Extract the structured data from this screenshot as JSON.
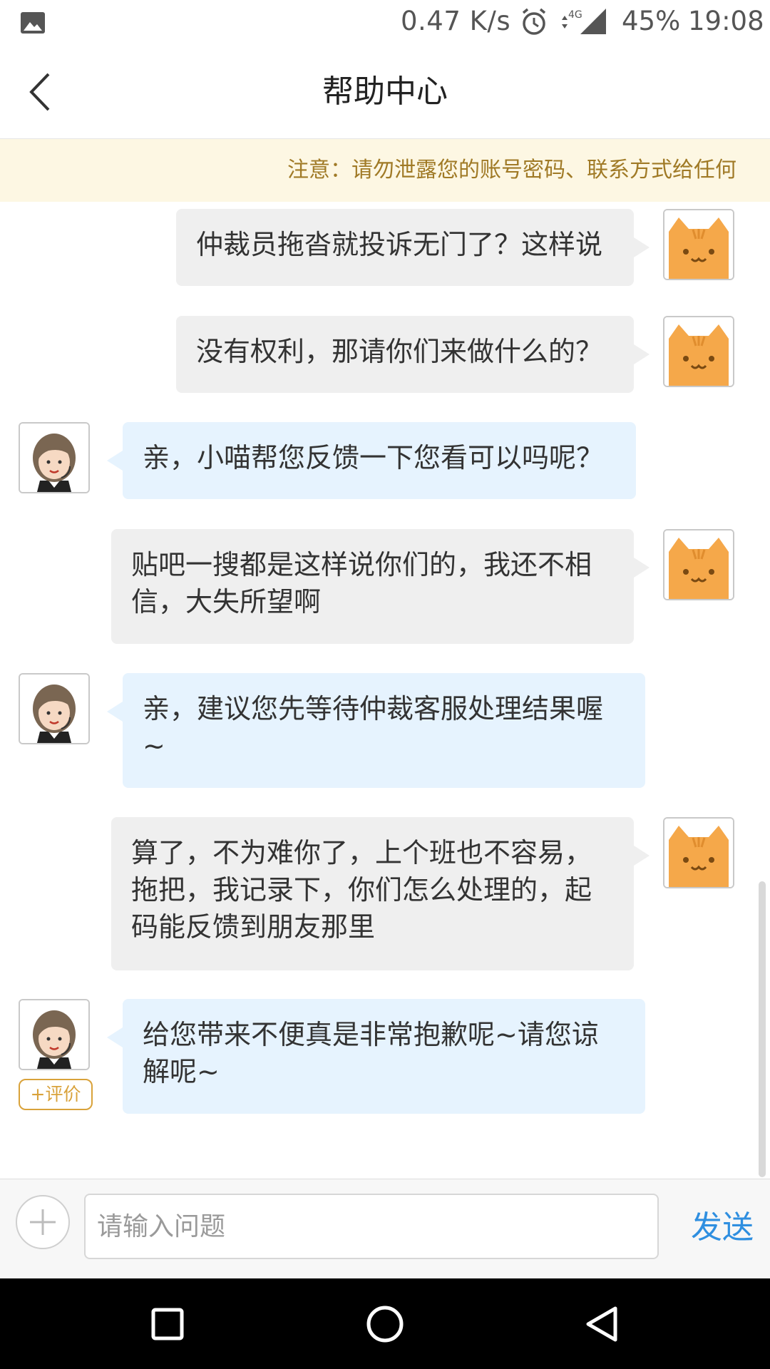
{
  "status_bar": {
    "network_speed": "0.47 K/s",
    "network_type": "4G",
    "battery": "45%",
    "time": "19:08"
  },
  "header": {
    "title": "帮助中心"
  },
  "notice": {
    "text": "注意：请勿泄露您的账号密码、联系方式给任何"
  },
  "messages": [
    {
      "sender": "user",
      "text": "仲裁员拖沓就投诉无门了？这样说"
    },
    {
      "sender": "user",
      "text": "没有权利，那请你们来做什么的？"
    },
    {
      "sender": "agent",
      "text": "亲，小喵帮您反馈一下您看可以吗呢？"
    },
    {
      "sender": "user",
      "text": "贴吧一搜都是这样说你们的，我还不相信，大失所望啊"
    },
    {
      "sender": "agent",
      "text": "亲，建议您先等待仲裁客服处理结果喔~"
    },
    {
      "sender": "user",
      "text": "算了，不为难你了，上个班也不容易，拖把，我记录下，你们怎么处理的，起码能反馈到朋友那里"
    },
    {
      "sender": "agent",
      "text": "给您带来不便真是非常抱歉呢~请您谅解呢~"
    }
  ],
  "rate_label": "+评价",
  "input": {
    "placeholder": "请输入问题",
    "value": ""
  },
  "send_label": "发送",
  "colors": {
    "user_bubble": "#efefef",
    "agent_bubble": "#e6f3fe",
    "notice_bg": "#fdf7e3",
    "notice_text": "#a07a26",
    "send": "#2f8fe0",
    "rate": "#d9a23a"
  }
}
